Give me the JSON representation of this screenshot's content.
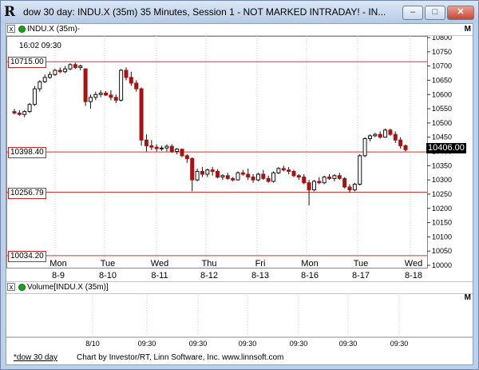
{
  "window": {
    "title": "dow 30 day: INDU.X (35m) 35 Minutes, Session 1 - NOT MARKED INTRADAY! - IN...",
    "app_icon": "R",
    "buttons": {
      "minimize": "–",
      "maximize": "□",
      "close": "✕"
    }
  },
  "price_pane": {
    "header_label": "INDU.X (35m)-",
    "close_glyph": "x",
    "menu_glyph": "M",
    "time_readout": "16:02  09:30",
    "horizontal_lines": [
      "10715.00",
      "10398.40",
      "10256.79",
      "10034.20"
    ],
    "last_price": "10406.00",
    "y_axis_labels": [
      "10800",
      "10750",
      "10700",
      "10650",
      "10600",
      "10550",
      "10500",
      "10450",
      "10400",
      "10350",
      "10300",
      "10250",
      "10200",
      "10150",
      "10100",
      "10050",
      "10000"
    ],
    "day_labels": [
      {
        "dow": "Mon",
        "date": "8-9"
      },
      {
        "dow": "Tue",
        "date": "8-10"
      },
      {
        "dow": "Wed",
        "date": "8-11"
      },
      {
        "dow": "Thu",
        "date": "8-12"
      },
      {
        "dow": "Fri",
        "date": "8-13"
      },
      {
        "dow": "Mon",
        "date": "8-16"
      },
      {
        "dow": "Tue",
        "date": "8-17"
      },
      {
        "dow": "Wed",
        "date": "8-18"
      }
    ]
  },
  "volume_pane": {
    "header_label": "Volume[INDU.X (35m)]",
    "close_glyph": "x",
    "menu_glyph": "M",
    "time_labels": [
      "8/10",
      "09:30",
      "09:30",
      "09:30",
      "09:30",
      "09:30",
      "09:30"
    ]
  },
  "footer": {
    "tab_label": "*dow 30 day",
    "credit": "Chart by Investor/RT, Linn Software, Inc. www.linnsoft.com"
  },
  "colors": {
    "up": "#111111",
    "down": "#aa1111",
    "hline": "#dd3333",
    "grid": "#dddddd"
  },
  "chart_data": {
    "type": "candlestick",
    "ylim": [
      10000,
      10800
    ],
    "y_ticks": [
      10000,
      10050,
      10100,
      10150,
      10200,
      10250,
      10300,
      10350,
      10400,
      10450,
      10500,
      10550,
      10600,
      10650,
      10700,
      10750,
      10800
    ],
    "horizontal_levels": [
      10715.0,
      10398.4,
      10256.79,
      10034.2
    ],
    "last_price": 10406.0,
    "categories": [
      "8-9",
      "8-10",
      "8-11",
      "8-12",
      "8-13",
      "8-16",
      "8-17",
      "8-18"
    ],
    "bars": [
      [
        10540,
        10550,
        10530,
        10535
      ],
      [
        10535,
        10545,
        10525,
        10530
      ],
      [
        10530,
        10545,
        10520,
        10540
      ],
      [
        10540,
        10570,
        10535,
        10565
      ],
      [
        10565,
        10630,
        10560,
        10620
      ],
      [
        10620,
        10650,
        10610,
        10645
      ],
      [
        10645,
        10670,
        10640,
        10660
      ],
      [
        10660,
        10680,
        10655,
        10670
      ],
      [
        10670,
        10690,
        10665,
        10685
      ],
      [
        10685,
        10695,
        10675,
        10680
      ],
      [
        10680,
        10700,
        10675,
        10690
      ],
      [
        10690,
        10710,
        10685,
        10705
      ],
      [
        10705,
        10712,
        10690,
        10695
      ],
      [
        10695,
        10705,
        10685,
        10700
      ],
      [
        10690,
        10692,
        10560,
        10575
      ],
      [
        10575,
        10600,
        10550,
        10590
      ],
      [
        10590,
        10610,
        10580,
        10600
      ],
      [
        10600,
        10615,
        10590,
        10605
      ],
      [
        10605,
        10612,
        10595,
        10598
      ],
      [
        10598,
        10615,
        10580,
        10590
      ],
      [
        10590,
        10600,
        10570,
        10580
      ],
      [
        10580,
        10690,
        10575,
        10685
      ],
      [
        10685,
        10695,
        10650,
        10660
      ],
      [
        10660,
        10680,
        10630,
        10640
      ],
      [
        10640,
        10650,
        10610,
        10620
      ],
      [
        10620,
        10625,
        10420,
        10440
      ],
      [
        10440,
        10460,
        10400,
        10420
      ],
      [
        10420,
        10440,
        10405,
        10415
      ],
      [
        10415,
        10425,
        10400,
        10410
      ],
      [
        10410,
        10420,
        10402,
        10412
      ],
      [
        10412,
        10425,
        10400,
        10418
      ],
      [
        10418,
        10425,
        10395,
        10400
      ],
      [
        10400,
        10412,
        10390,
        10408
      ],
      [
        10408,
        10410,
        10380,
        10385
      ],
      [
        10385,
        10390,
        10360,
        10375
      ],
      [
        10375,
        10380,
        10260,
        10300
      ],
      [
        10300,
        10340,
        10295,
        10330
      ],
      [
        10330,
        10345,
        10310,
        10320
      ],
      [
        10320,
        10340,
        10310,
        10335
      ],
      [
        10335,
        10345,
        10315,
        10330
      ],
      [
        10330,
        10338,
        10305,
        10310
      ],
      [
        10310,
        10320,
        10300,
        10315
      ],
      [
        10315,
        10325,
        10300,
        10305
      ],
      [
        10305,
        10310,
        10295,
        10300
      ],
      [
        10300,
        10330,
        10298,
        10325
      ],
      [
        10325,
        10335,
        10315,
        10320
      ],
      [
        10320,
        10340,
        10300,
        10310
      ],
      [
        10310,
        10320,
        10290,
        10300
      ],
      [
        10300,
        10325,
        10295,
        10320
      ],
      [
        10320,
        10335,
        10300,
        10305
      ],
      [
        10305,
        10315,
        10290,
        10295
      ],
      [
        10295,
        10330,
        10290,
        10325
      ],
      [
        10325,
        10345,
        10320,
        10340
      ],
      [
        10340,
        10350,
        10330,
        10335
      ],
      [
        10335,
        10345,
        10320,
        10330
      ],
      [
        10330,
        10335,
        10310,
        10315
      ],
      [
        10315,
        10320,
        10300,
        10310
      ],
      [
        10310,
        10320,
        10285,
        10290
      ],
      [
        10290,
        10300,
        10210,
        10265
      ],
      [
        10265,
        10300,
        10260,
        10295
      ],
      [
        10295,
        10310,
        10285,
        10290
      ],
      [
        10290,
        10315,
        10285,
        10310
      ],
      [
        10310,
        10320,
        10300,
        10305
      ],
      [
        10305,
        10320,
        10295,
        10315
      ],
      [
        10315,
        10325,
        10300,
        10305
      ],
      [
        10305,
        10310,
        10270,
        10275
      ],
      [
        10275,
        10285,
        10255,
        10265
      ],
      [
        10265,
        10290,
        10260,
        10285
      ],
      [
        10285,
        10390,
        10280,
        10385
      ],
      [
        10385,
        10450,
        10380,
        10445
      ],
      [
        10445,
        10460,
        10435,
        10455
      ],
      [
        10455,
        10465,
        10450,
        10460
      ],
      [
        10460,
        10470,
        10445,
        10450
      ],
      [
        10450,
        10480,
        10448,
        10475
      ],
      [
        10475,
        10480,
        10455,
        10460
      ],
      [
        10460,
        10470,
        10430,
        10440
      ],
      [
        10440,
        10450,
        10410,
        10420
      ],
      [
        10420,
        10425,
        10400,
        10406
      ]
    ]
  }
}
